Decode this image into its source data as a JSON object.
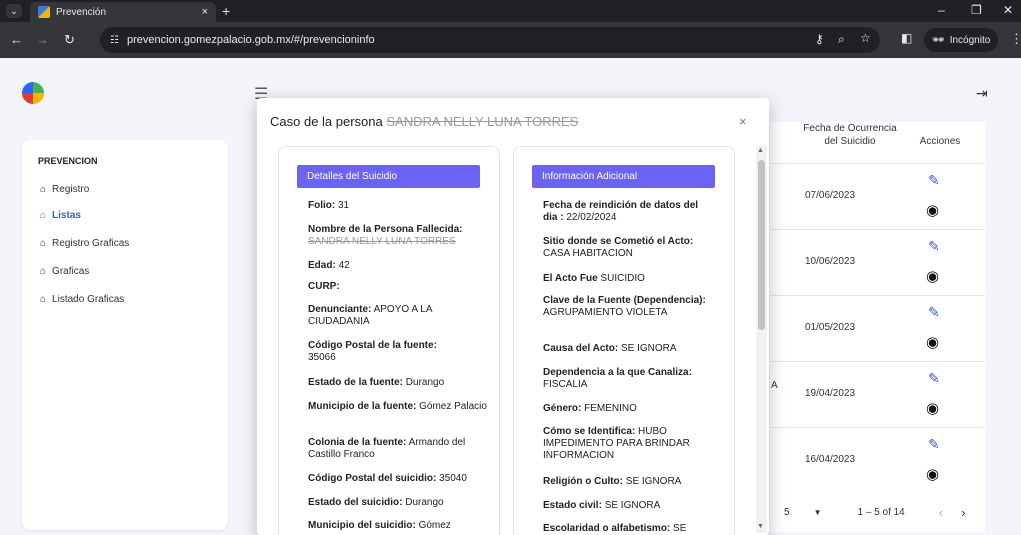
{
  "browser": {
    "tab_title": "Prevención",
    "tab_close": "×",
    "new_tab": "+",
    "url": "prevencion.gomezpalacio.gob.mx/#/prevencioninfo",
    "incognito_label": "Incógnito",
    "minimize": "–",
    "restore": "❐",
    "close": "✕"
  },
  "sidebar": {
    "section_title": "PREVENCION",
    "items": [
      {
        "label": "Registro",
        "active": false
      },
      {
        "label": "Listas",
        "active": true
      },
      {
        "label": "Registro Graficas",
        "active": false
      },
      {
        "label": "Graficas",
        "active": false
      },
      {
        "label": "Listado Graficas",
        "active": false
      }
    ]
  },
  "table": {
    "headers": {
      "fecha": "Fecha de Ocurrencia del Suicidio",
      "acciones": "Acciones"
    },
    "rows": [
      {
        "fecha": "07/06/2023"
      },
      {
        "fecha": "10/06/2023"
      },
      {
        "fecha": "01/05/2023"
      },
      {
        "fecha": "19/04/2023"
      },
      {
        "fecha": "16/04/2023"
      }
    ],
    "stray_text": "A",
    "pager": {
      "per_page": "5",
      "range": "1 – 5 of 14"
    }
  },
  "modal": {
    "title_prefix": "Caso de la persona",
    "title_name": "SANDRA NELLY LUNA TORRES",
    "close": "×",
    "left": {
      "heading": "Detalles del Suicidio",
      "folio_label": "Folio:",
      "folio": "31",
      "nombre_label": "Nombre de la Persona Fallecida:",
      "nombre": "SANDRA NELLY LUNA TORRES",
      "edad_label": "Edad:",
      "edad": "42",
      "curp_label": "CURP:",
      "denunciante_label": "Denunciante:",
      "denunciante": "APOYO A LA CIUDADANIA",
      "cp_fuente_label": "Código Postal de la fuente:",
      "cp_fuente": "35066",
      "estado_fuente_label": "Estado de la fuente:",
      "estado_fuente": "Durango",
      "municipio_fuente_label": "Municipio de la fuente:",
      "municipio_fuente": "Gómez Palacio",
      "colonia_fuente_label": "Colonia de la fuente:",
      "colonia_fuente": "Armando del Castillo Franco",
      "cp_suicidio_label": "Código Postal del suicidio:",
      "cp_suicidio": "35040",
      "estado_suicidio_label": "Estado del suicidio:",
      "estado_suicidio": "Durango",
      "municipio_suicidio_label": "Municipio del suicidio:",
      "municipio_suicidio": "Gómez"
    },
    "right": {
      "heading": "Información Adicional",
      "reindicion_label": "Fecha de reindición de datos del dia :",
      "reindicion": "22/02/2024",
      "sitio_label": "Sitio donde se Cometió el Acto:",
      "sitio": "CASA HABITACION",
      "acto_label": "El Acto Fue",
      "acto": "SUICIDIO",
      "clave_label": "Clave de la Fuente (Dependencia):",
      "clave": "AGRUPAMIENTO VIOLETA",
      "causa_label": "Causa del Acto:",
      "causa": "SE IGNORA",
      "dependencia_label": "Dependencia a la que Canaliza:",
      "dependencia": "FISCALIA",
      "genero_label": "Género:",
      "genero": "FEMENINO",
      "identifica_label": "Cómo se Identifica:",
      "identifica": "HUBO IMPEDIMENTO PARA BRINDAR INFORMACION",
      "religion_label": "Religión o Culto:",
      "religion": "SE IGNORA",
      "civil_label": "Estado civil:",
      "civil": "SE IGNORA",
      "escolaridad_label": "Escolaridad o alfabetismo:",
      "escolaridad": "SE"
    }
  }
}
